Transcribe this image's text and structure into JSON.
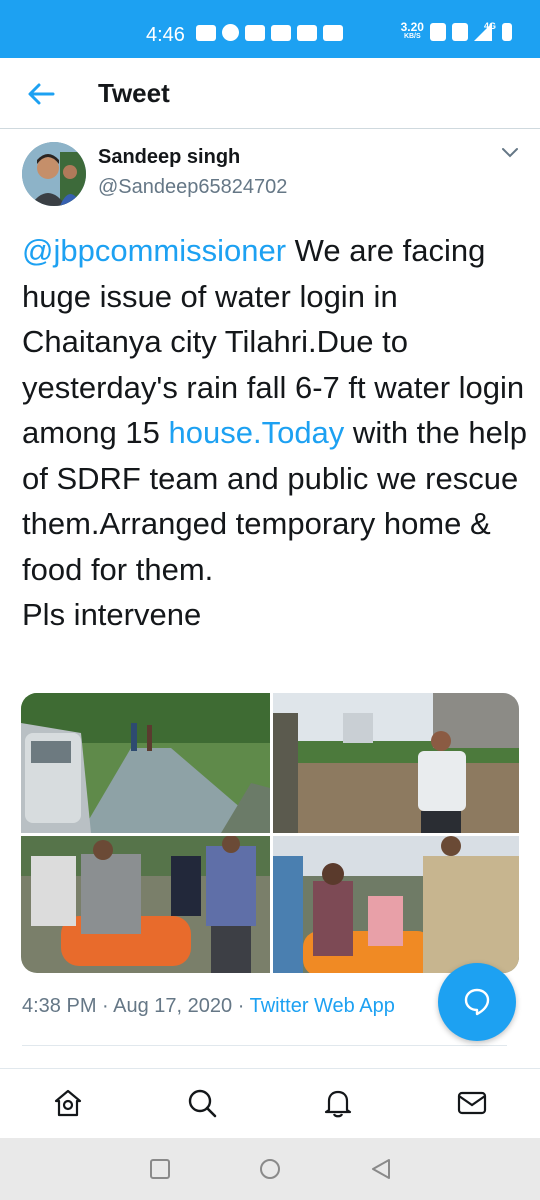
{
  "status_bar": {
    "time": "4:46",
    "speed": "3.20",
    "speed_unit": "KB/S",
    "network": "4G"
  },
  "header": {
    "title": "Tweet"
  },
  "tweet": {
    "name": "Sandeep singh",
    "handle": "@Sandeep65824702",
    "mention": "@jbpcommissioner",
    "text_1": " We are facing huge issue of water login in Chaitanya city Tilahri.Due to yesterday's rain fall 6-7 ft water login among 15 ",
    "link": "house.Today",
    "text_2": " with the help of SDRF team and public we rescue them.Arranged temporary home & food for them.",
    "text_3": "Pls intervene",
    "time": "4:38 PM",
    "date": "Aug 17, 2020",
    "source": "Twitter Web App",
    "separator": " · "
  },
  "colors": {
    "accent": "#1da1f2",
    "secondary_text": "#657786",
    "divider": "#cfd9de"
  },
  "icons": {
    "back": "arrow-left-icon",
    "caret": "chevron-down-icon",
    "fab": "compose-reply-icon",
    "home": "home-icon",
    "search": "search-icon",
    "notifications": "bell-icon",
    "messages": "mail-icon"
  }
}
